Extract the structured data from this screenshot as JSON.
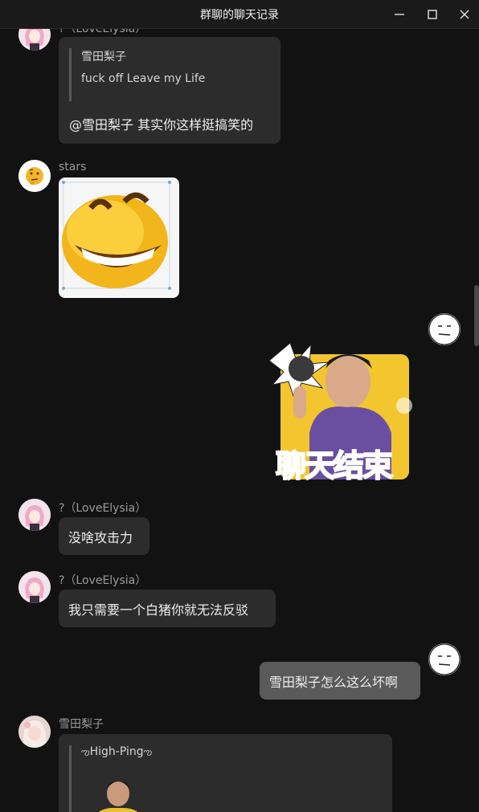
{
  "window": {
    "title": "群聊的聊天记录",
    "controls": [
      "minimize-icon",
      "maximize-icon",
      "close-icon"
    ]
  },
  "messages": [
    {
      "sender": "?（LoveElysia）",
      "quote": {
        "name": "雪田梨子",
        "text": "fuck off Leave my Life"
      },
      "text": "@雪田梨子 其实你这样挺搞笑的"
    },
    {
      "sender": "stars",
      "image": "laughing-emoji-sticker"
    },
    {
      "self": true,
      "image": "chat-ended-sticker",
      "sticker_text": "聊天结束"
    },
    {
      "sender": "?（LoveElysia）",
      "text": "没啥攻击力"
    },
    {
      "sender": "?（LoveElysia）",
      "text": "我只需要一个白猪你就无法反驳"
    },
    {
      "self": true,
      "text": "雪田梨子怎么这么坏啊"
    },
    {
      "sender": "雪田梨子",
      "quote": {
        "name": "High-Ping",
        "image": "boy-photo-thumbnail"
      }
    }
  ],
  "colors": {
    "background": "#121212",
    "bubble_other": "#2c2c2c",
    "bubble_self": "#5a5a5a",
    "sender_name": "#9a9a9a"
  }
}
